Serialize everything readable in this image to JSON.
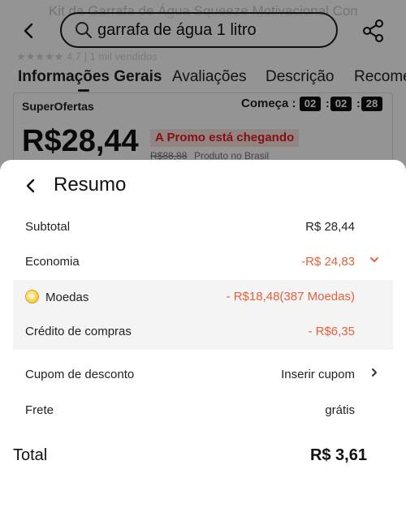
{
  "background": {
    "product_title_faded": "Kit da Garrafa de Água Squeeze Motivacional Com",
    "rating_faded": "★★★★★ 4,7 | 1 mil vendidos",
    "search": {
      "query": "garrafa de água 1 litro"
    },
    "tabs": [
      "Informações Gerais",
      "Avaliações",
      "Descrição",
      "Recomendações"
    ],
    "promo": {
      "badge": "SuperOfertas",
      "starts_label": "Começa :",
      "timer": [
        "02",
        "02",
        "28"
      ],
      "price": "R$28,44",
      "promo_tag": "A Promo está chegando",
      "old_price": "R$88,88",
      "origin": "Produto no Brasil"
    }
  },
  "sheet": {
    "title": "Resumo",
    "rows": {
      "subtotal": {
        "label": "Subtotal",
        "value": "R$ 28,44"
      },
      "economia": {
        "label": "Economia",
        "value": "-R$ 24,83",
        "side": "↳"
      },
      "moedas": {
        "label": "Moedas",
        "value": "- R$18,48(387 Moedas)"
      },
      "credito": {
        "label": "Crédito de compras",
        "value": "- R$6,35"
      },
      "cupom": {
        "label": "Cupom de desconto",
        "value": "Inserir cupom",
        "side": "›"
      },
      "frete": {
        "label": "Frete",
        "value": "grátis"
      }
    },
    "total": {
      "label": "Total",
      "value": "R$ 3,61"
    }
  },
  "colors": {
    "accent_red": "#e5603c",
    "promo_red": "#e02020",
    "coin_gold": "#f6d35a"
  },
  "icons": [
    "back-arrow-icon",
    "search-icon",
    "share-icon",
    "coin-icon",
    "chevron-down-icon",
    "chevron-right-icon"
  ]
}
